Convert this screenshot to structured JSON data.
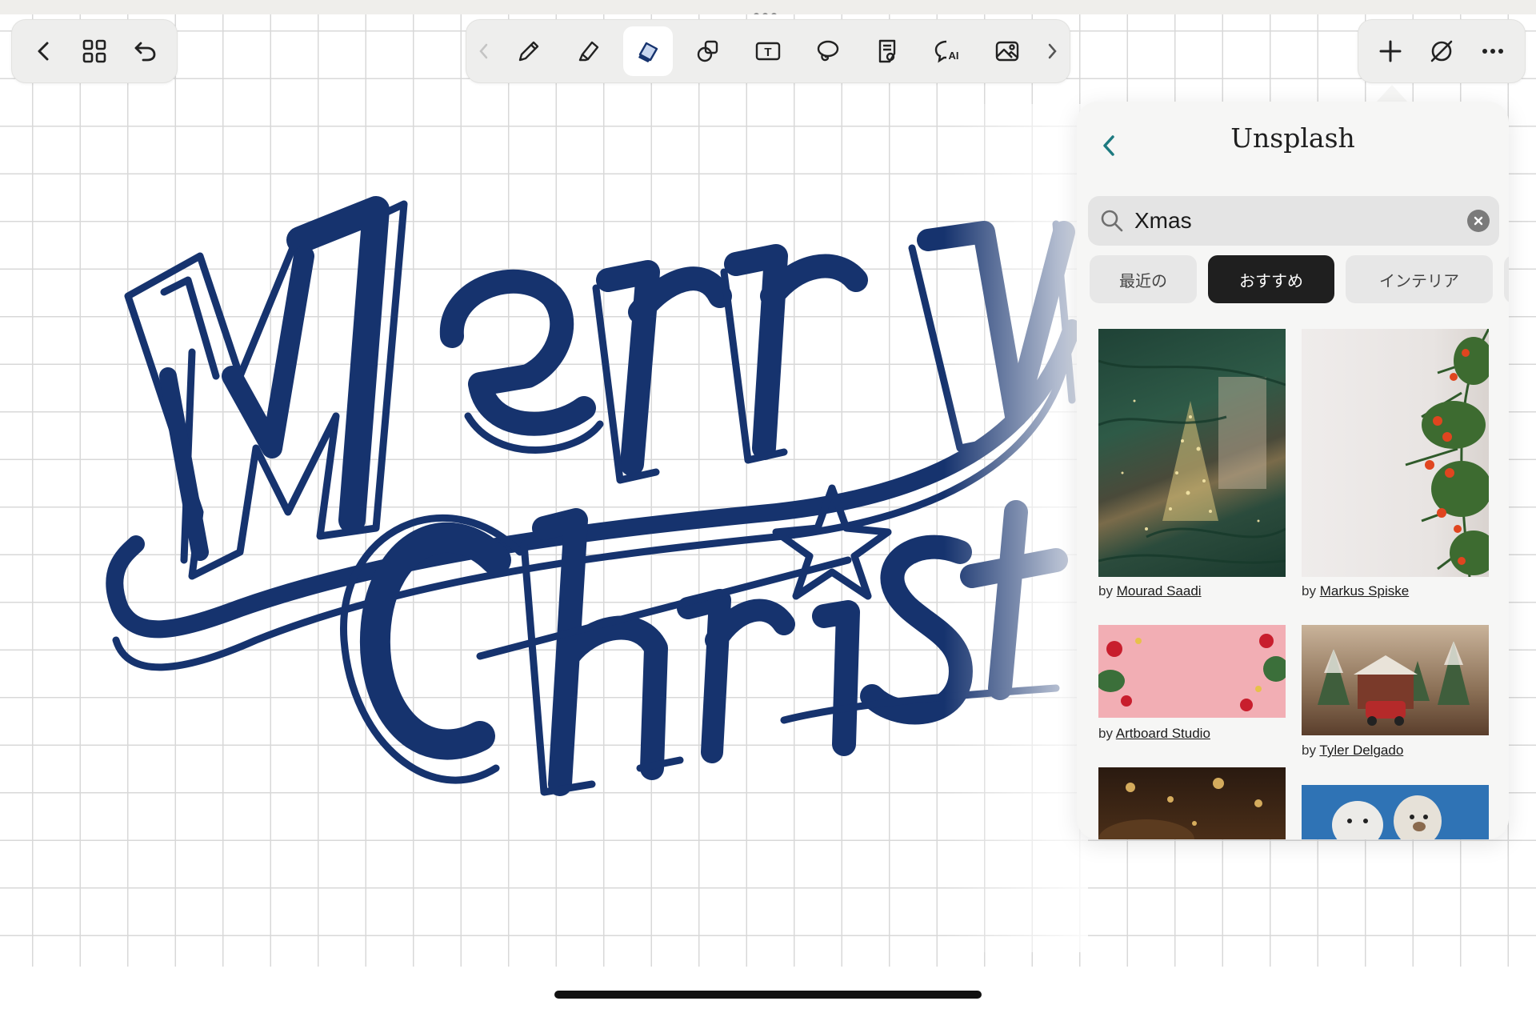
{
  "colors": {
    "ink": "#16336e",
    "accent_teal": "#1d7a80",
    "selected_chip_bg": "#1f1f1f",
    "toolbar_bg": "#eeeeed"
  },
  "toolbar_left": {
    "items": [
      {
        "name": "back",
        "icon": "chevron-left-icon"
      },
      {
        "name": "pages-grid",
        "icon": "grid-icon"
      },
      {
        "name": "undo",
        "icon": "undo-icon"
      }
    ]
  },
  "toolbar_center": {
    "active_tool": "eraser",
    "tools": [
      {
        "name": "pen",
        "icon": "pen-icon"
      },
      {
        "name": "highlighter",
        "icon": "highlighter-icon"
      },
      {
        "name": "eraser",
        "icon": "eraser-icon"
      },
      {
        "name": "shapes",
        "icon": "shapes-icon"
      },
      {
        "name": "text",
        "icon": "text-box-icon"
      },
      {
        "name": "lasso",
        "icon": "lasso-icon"
      },
      {
        "name": "sticker",
        "icon": "sticker-icon"
      },
      {
        "name": "ai",
        "icon": "ai-chat-icon",
        "label": "AI"
      },
      {
        "name": "image",
        "icon": "image-icon"
      }
    ],
    "text_tool_label": "T"
  },
  "toolbar_right": {
    "items": [
      {
        "name": "add",
        "icon": "plus-icon"
      },
      {
        "name": "pencil-off",
        "icon": "pencil-slash-icon"
      },
      {
        "name": "more",
        "icon": "more-horizontal-icon"
      }
    ]
  },
  "unsplash_panel": {
    "title": "Unsplash",
    "search_value": "Xmas",
    "search_placeholder": "",
    "chips": [
      {
        "label": "最近の",
        "selected": false
      },
      {
        "label": "おすすめ",
        "selected": true
      },
      {
        "label": "インテリア",
        "selected": false
      }
    ],
    "photos": [
      {
        "by": "by",
        "author": "Mourad Saadi"
      },
      {
        "by": "by",
        "author": "Markus Spiske"
      },
      {
        "by": "by",
        "author": "Artboard Studio"
      },
      {
        "by": "by",
        "author": "Tyler Delgado"
      }
    ]
  }
}
